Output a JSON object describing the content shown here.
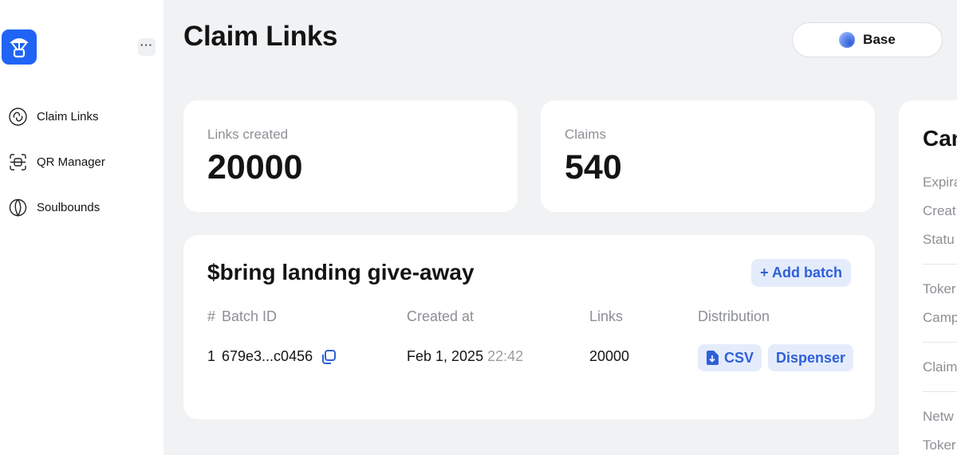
{
  "sidebar": {
    "more_label": "···",
    "items": [
      {
        "label": "Claim Links",
        "icon": "claim-links-icon"
      },
      {
        "label": "QR Manager",
        "icon": "qr-manager-icon"
      },
      {
        "label": "Soulbounds",
        "icon": "soulbounds-icon"
      }
    ]
  },
  "header": {
    "title": "Claim Links",
    "network": "Base"
  },
  "stats": {
    "links_label": "Links created",
    "links_value": "20000",
    "claims_label": "Claims",
    "claims_value": "540"
  },
  "campaign": {
    "title": "$bring landing give-away",
    "add_batch": "+ Add batch",
    "columns": {
      "hash": "#",
      "batch_id": "Batch ID",
      "created_at": "Created at",
      "links": "Links",
      "distribution": "Distribution"
    },
    "rows": [
      {
        "index": "1",
        "batch_id": "679e3...c0456",
        "date": "Feb 1, 2025",
        "time": "22:42",
        "links": "20000",
        "csv_label": "CSV",
        "dispenser_label": "Dispenser"
      }
    ]
  },
  "details": {
    "title": "Can",
    "rows": [
      "Expira",
      "Creat",
      "Statu",
      "Toker",
      "Camp",
      "Claim",
      "Netw",
      "Toker"
    ]
  },
  "colors": {
    "accent": "#1f64f5",
    "pill_bg": "#e4ecfc",
    "pill_text": "#2f5fd9",
    "background": "#f1f2f4"
  }
}
